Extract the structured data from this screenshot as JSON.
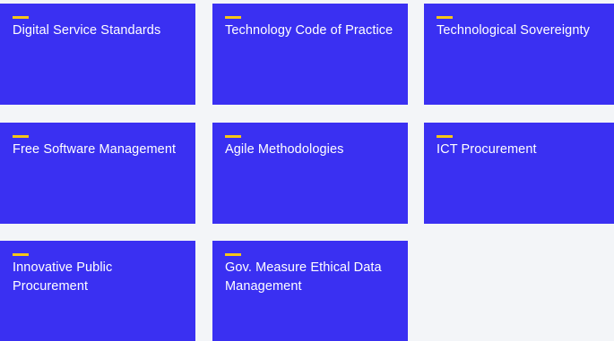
{
  "colors": {
    "page_background": "#F3F5F8",
    "card_background": "#3A30F2",
    "accent_bar": "#F5C518",
    "card_text": "#FFFFFF"
  },
  "cards": [
    {
      "title": "Digital Service Standards"
    },
    {
      "title": "Technology Code of Practice"
    },
    {
      "title": "Technological Sovereignty"
    },
    {
      "title": "Free Software Management"
    },
    {
      "title": "Agile Methodologies"
    },
    {
      "title": "ICT Procurement"
    },
    {
      "title": "Innovative Public Procurement"
    },
    {
      "title": "Gov. Measure Ethical Data Management"
    }
  ]
}
